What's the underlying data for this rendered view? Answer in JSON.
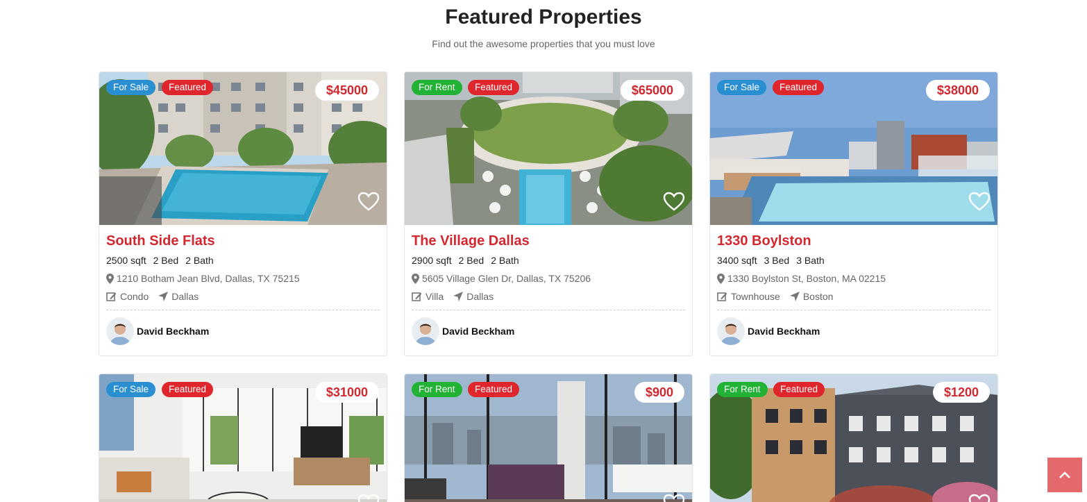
{
  "section": {
    "title": "Featured Properties",
    "subtitle": "Find out the awesome properties that you must love"
  },
  "colors": {
    "accent": "#d3262e",
    "for_sale": "#2a8fd0",
    "for_rent": "#22b236",
    "featured": "#e0262d",
    "scroll_top": "#e4696d"
  },
  "properties": [
    {
      "status": "For Sale",
      "featured": "Featured",
      "price": "$45000",
      "title": "South Side Flats",
      "sqft": "2500 sqft",
      "beds": "2 Bed",
      "baths": "2 Bath",
      "address": "1210 Botham Jean Blvd, Dallas, TX 75215",
      "type": "Condo",
      "city": "Dallas",
      "agent": "David Beckham"
    },
    {
      "status": "For Rent",
      "featured": "Featured",
      "price": "$65000",
      "title": "The Village Dallas",
      "sqft": "2900 sqft",
      "beds": "2 Bed",
      "baths": "2 Bath",
      "address": "5605 Village Glen Dr, Dallas, TX 75206",
      "type": "Villa",
      "city": "Dallas",
      "agent": "David Beckham"
    },
    {
      "status": "For Sale",
      "featured": "Featured",
      "price": "$38000",
      "title": "1330 Boylston",
      "sqft": "3400 sqft",
      "beds": "3 Bed",
      "baths": "3 Bath",
      "address": "1330 Boylston St, Boston, MA 02215",
      "type": "Townhouse",
      "city": "Boston",
      "agent": "David Beckham"
    },
    {
      "status": "For Sale",
      "featured": "Featured",
      "price": "$31000"
    },
    {
      "status": "For Rent",
      "featured": "Featured",
      "price": "$900"
    },
    {
      "status": "For Rent",
      "featured": "Featured",
      "price": "$1200"
    }
  ],
  "icons": {
    "favorite": "heart-icon",
    "location": "map-marker-icon",
    "type": "edit-icon",
    "city": "location-arrow-icon",
    "scroll": "chevron-up-icon"
  }
}
